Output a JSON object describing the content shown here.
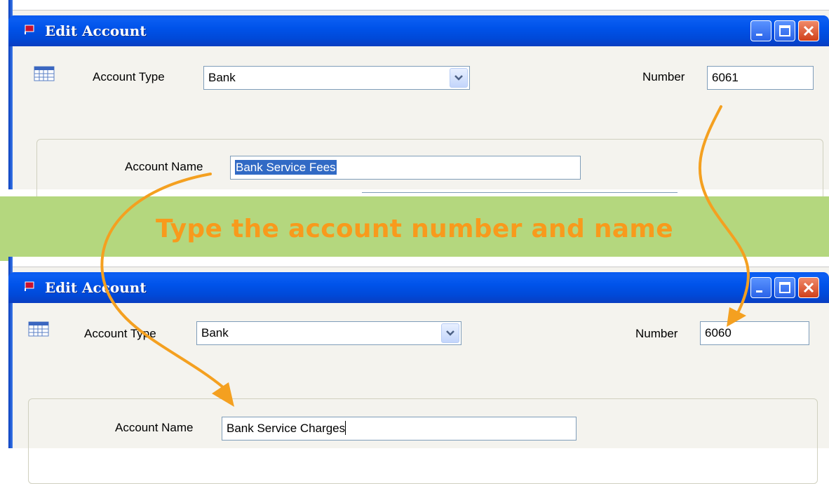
{
  "banner": {
    "text": "Type the account number and name"
  },
  "colors": {
    "titlebar": "#0053ea",
    "banner_bg": "#b4d77e",
    "banner_text": "#f89a1c",
    "selection": "#316ac5",
    "arrow": "#f4a020"
  },
  "window_before": {
    "title": "Edit Account",
    "account_type_label": "Account Type",
    "account_type_value": "Bank",
    "number_label": "Number",
    "number_value": "6061",
    "account_name_label": "Account Name",
    "account_name_value": "Bank Service Fees"
  },
  "window_after": {
    "title": "Edit Account",
    "account_type_label": "Account Type",
    "account_type_value": "Bank",
    "number_label": "Number",
    "number_value": "6060",
    "account_name_label": "Account Name",
    "account_name_value": "Bank Service Charges"
  },
  "icons": {
    "window_icon": "quickbooks-window-icon",
    "account_type_icon": "ledger-grid-icon",
    "dropdown": "chevron-down-icon",
    "minimize": "minimize-icon",
    "maximize": "maximize-icon",
    "close": "close-icon"
  }
}
